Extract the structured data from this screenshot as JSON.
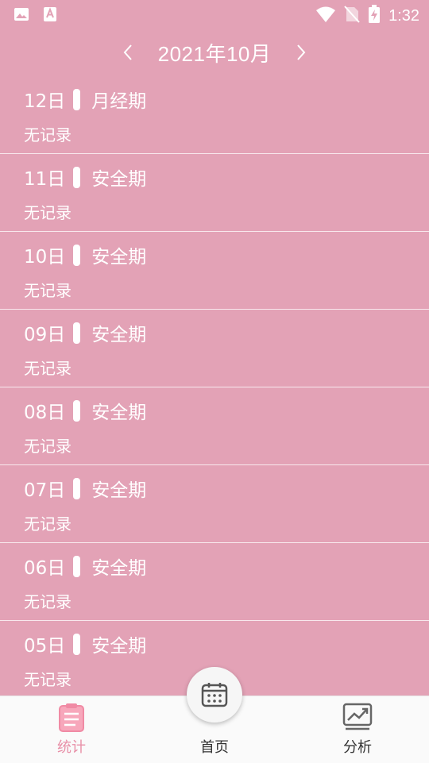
{
  "status_bar": {
    "time": "1:32",
    "icons": [
      "image-icon",
      "font-icon",
      "wifi-icon",
      "no-sim-icon",
      "battery-charging-icon"
    ]
  },
  "header": {
    "month": "2021年10月",
    "prev_icon": "chevron-left-icon",
    "next_icon": "chevron-right-icon"
  },
  "days": [
    {
      "day": "12日",
      "phase": "月经期",
      "record": "无记录"
    },
    {
      "day": "11日",
      "phase": "安全期",
      "record": "无记录"
    },
    {
      "day": "10日",
      "phase": "安全期",
      "record": "无记录"
    },
    {
      "day": "09日",
      "phase": "安全期",
      "record": "无记录"
    },
    {
      "day": "08日",
      "phase": "安全期",
      "record": "无记录"
    },
    {
      "day": "07日",
      "phase": "安全期",
      "record": "无记录"
    },
    {
      "day": "06日",
      "phase": "安全期",
      "record": "无记录"
    },
    {
      "day": "05日",
      "phase": "安全期",
      "record": "无记录"
    }
  ],
  "tabs": [
    {
      "label": "统计",
      "icon": "clipboard-icon",
      "active": true
    },
    {
      "label": "首页",
      "icon": "calendar-icon",
      "active": false
    },
    {
      "label": "分析",
      "icon": "chart-icon",
      "active": false
    }
  ],
  "colors": {
    "background": "#e3a2b6",
    "active_tab": "#e890a8",
    "tabbar": "#fafafa"
  }
}
